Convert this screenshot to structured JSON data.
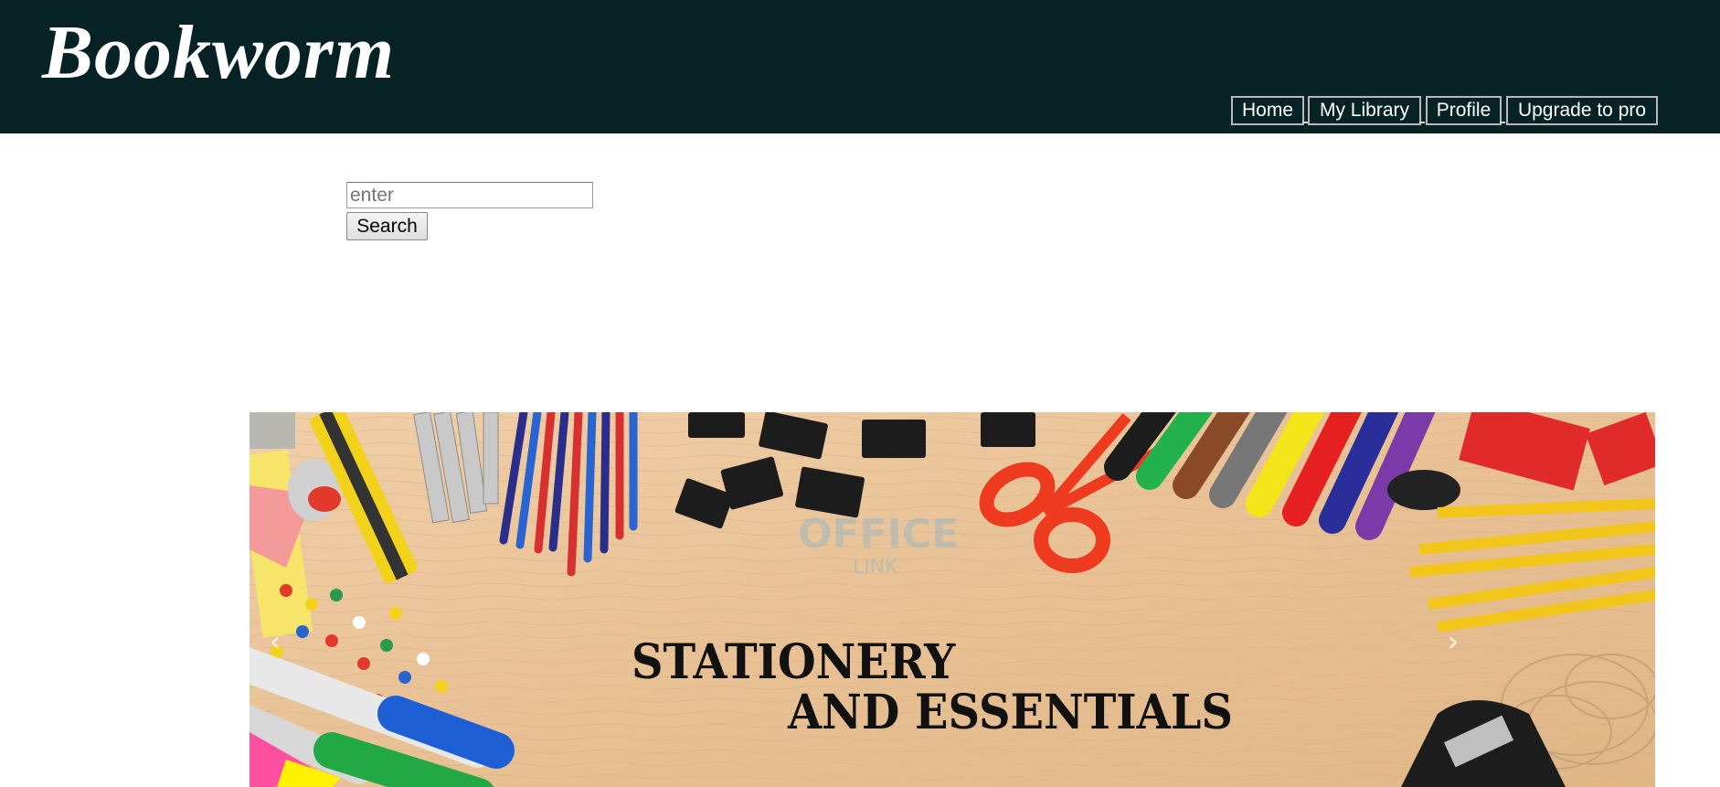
{
  "header": {
    "brand": "Bookworm",
    "nav": [
      {
        "label": "Home"
      },
      {
        "label": "My Library"
      },
      {
        "label": "Profile"
      },
      {
        "label": "Upgrade to pro"
      }
    ]
  },
  "search": {
    "placeholder": "enter",
    "value": "",
    "button_label": "Search"
  },
  "carousel": {
    "headline_line1": "STATIONERY",
    "headline_line2": "AND ESSENTIALS",
    "watermark": "OFFICE LINK",
    "prev_icon": "‹",
    "next_icon": "›"
  },
  "colors": {
    "header_bg": "#062224",
    "header_text": "#ffffff",
    "wood": "#e9c49b"
  }
}
